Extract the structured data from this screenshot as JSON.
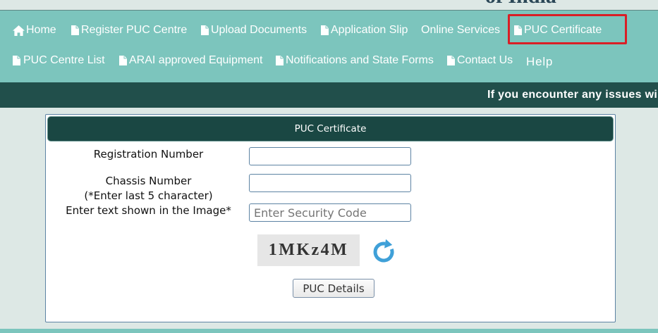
{
  "site": {
    "title_fragment": "of India"
  },
  "nav": {
    "items": [
      {
        "label": "Home",
        "icon": "home-icon"
      },
      {
        "label": "Register PUC Centre",
        "icon": "document-icon"
      },
      {
        "label": "Upload Documents",
        "icon": "document-icon"
      },
      {
        "label": "Application Slip",
        "icon": "document-icon"
      },
      {
        "label": "Online Services"
      },
      {
        "label": "PUC Certificate",
        "icon": "document-icon",
        "active": true
      },
      {
        "label": "PUC Centre List",
        "icon": "document-icon"
      },
      {
        "label": "ARAI approved Equipment",
        "icon": "document-icon"
      },
      {
        "label": "Notifications and State Forms",
        "icon": "document-icon"
      },
      {
        "label": "Contact Us",
        "icon": "document-icon"
      },
      {
        "label": "Help"
      }
    ]
  },
  "notice": {
    "text": "If you encounter any issues wi"
  },
  "form": {
    "title": "PUC Certificate",
    "registration_label": "Registration Number",
    "chassis_label": "Chassis Number",
    "chassis_hint": "(*Enter last 5 character)",
    "captcha_label": "Enter text shown in the Image*",
    "captcha_placeholder": "Enter Security Code",
    "captcha_text": "1MKz4M",
    "refresh_icon": "refresh-icon",
    "submit_label": "PUC Details"
  },
  "theme": {
    "nav_bg": "#7cc5bd",
    "notice_bg": "#214f4b",
    "page_bg": "#dde8e5",
    "panel_header_bg": "#1a4743",
    "highlight": "#d91f26",
    "refresh": "#3fa0d8",
    "field_border": "#5d83a3",
    "brand_text": "#2b4757"
  }
}
